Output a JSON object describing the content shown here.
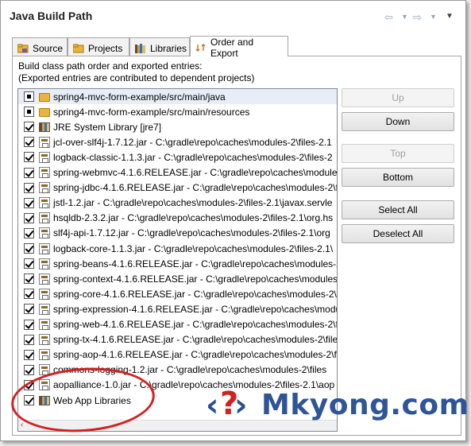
{
  "window": {
    "title": "Java Build Path"
  },
  "tabs": [
    {
      "label": "Source",
      "icon": "source-folder-icon"
    },
    {
      "label": "Projects",
      "icon": "projects-icon"
    },
    {
      "label": "Libraries",
      "icon": "libraries-icon"
    },
    {
      "label": "Order and Export",
      "icon": "order-export-icon",
      "active": true
    }
  ],
  "description": {
    "line1": "Build class path order and exported entries:",
    "line2": "(Exported entries are contributed to dependent projects)"
  },
  "entries": [
    {
      "label": "spring4-mvc-form-example/src/main/java",
      "icon": "source-folder-icon",
      "check": "partial",
      "selected": true
    },
    {
      "label": "spring4-mvc-form-example/src/main/resources",
      "icon": "source-folder-icon",
      "check": "partial"
    },
    {
      "label": "JRE System Library [jre7]",
      "icon": "library-icon",
      "check": "checked"
    },
    {
      "label": "jcl-over-slf4j-1.7.12.jar - C:\\gradle\\repo\\caches\\modules-2\\files-2.1",
      "icon": "jar-icon",
      "check": "checked"
    },
    {
      "label": "logback-classic-1.1.3.jar - C:\\gradle\\repo\\caches\\modules-2\\files-2",
      "icon": "jar-icon",
      "check": "checked"
    },
    {
      "label": "spring-webmvc-4.1.6.RELEASE.jar - C:\\gradle\\repo\\caches\\modules-2\\",
      "icon": "jar-icon",
      "check": "checked"
    },
    {
      "label": "spring-jdbc-4.1.6.RELEASE.jar - C:\\gradle\\repo\\caches\\modules-2\\file",
      "icon": "jar-icon",
      "check": "checked"
    },
    {
      "label": "jstl-1.2.jar - C:\\gradle\\repo\\caches\\modules-2\\files-2.1\\javax.servle",
      "icon": "jar-icon",
      "check": "checked"
    },
    {
      "label": "hsqldb-2.3.2.jar - C:\\gradle\\repo\\caches\\modules-2\\files-2.1\\org.hs",
      "icon": "jar-icon",
      "check": "checked"
    },
    {
      "label": "slf4j-api-1.7.12.jar - C:\\gradle\\repo\\caches\\modules-2\\files-2.1\\org",
      "icon": "jar-icon",
      "check": "checked"
    },
    {
      "label": "logback-core-1.1.3.jar - C:\\gradle\\repo\\caches\\modules-2\\files-2.1\\",
      "icon": "jar-icon",
      "check": "checked"
    },
    {
      "label": "spring-beans-4.1.6.RELEASE.jar - C:\\gradle\\repo\\caches\\modules-2\\fi",
      "icon": "jar-icon",
      "check": "checked"
    },
    {
      "label": "spring-context-4.1.6.RELEASE.jar - C:\\gradle\\repo\\caches\\modules-",
      "icon": "jar-icon",
      "check": "checked"
    },
    {
      "label": "spring-core-4.1.6.RELEASE.jar - C:\\gradle\\repo\\caches\\modules-2\\f",
      "icon": "jar-icon",
      "check": "checked"
    },
    {
      "label": "spring-expression-4.1.6.RELEASE.jar - C:\\gradle\\repo\\caches\\modu",
      "icon": "jar-icon",
      "check": "checked"
    },
    {
      "label": "spring-web-4.1.6.RELEASE.jar - C:\\gradle\\repo\\caches\\modules-2\\fi",
      "icon": "jar-icon",
      "check": "checked"
    },
    {
      "label": "spring-tx-4.1.6.RELEASE.jar - C:\\gradle\\repo\\caches\\modules-2\\file",
      "icon": "jar-icon",
      "check": "checked"
    },
    {
      "label": "spring-aop-4.1.6.RELEASE.jar - C:\\gradle\\repo\\caches\\modules-2\\fi",
      "icon": "jar-icon",
      "check": "checked"
    },
    {
      "label": "commons-logging-1.2.jar - C:\\gradle\\repo\\caches\\modules-2\\files",
      "icon": "jar-icon",
      "check": "checked"
    },
    {
      "label": "aopalliance-1.0.jar - C:\\gradle\\repo\\caches\\modules-2\\files-2.1\\aop",
      "icon": "jar-icon",
      "check": "checked"
    },
    {
      "label": "Web App Libraries",
      "icon": "library-icon",
      "check": "checked",
      "highlighted": true
    }
  ],
  "buttons": {
    "up": "Up",
    "down": "Down",
    "top": "Top",
    "bottom": "Bottom",
    "select_all": "Select All",
    "deselect_all": "Deselect All"
  },
  "watermark": {
    "text": "Mkyong.com"
  },
  "colors": {
    "highlight_oval": "#d42020",
    "selected_row": "#e8eef7",
    "watermark_blue": "#2f5597"
  }
}
